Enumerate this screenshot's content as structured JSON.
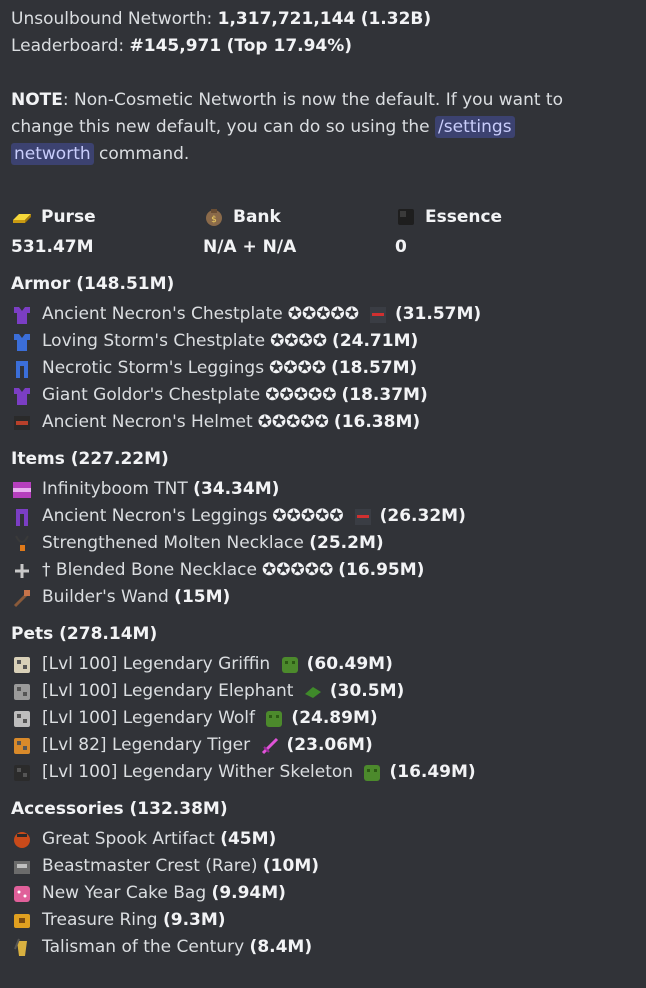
{
  "header": {
    "networth_label": "Unsoulbound Networth:",
    "networth_value": "1,317,721,144",
    "networth_short": "(1.32B)",
    "leaderboard_label": "Leaderboard:",
    "leaderboard_rank": "#145,971",
    "leaderboard_top": "(Top 17.94%)"
  },
  "note": {
    "label": "NOTE",
    "text1": ": Non-Cosmetic Networth is now the default. If you want to",
    "text2": "change this new default, you can do so using the",
    "command_part1": "/settings",
    "command_part2": "networth",
    "text3": "command."
  },
  "fields": [
    {
      "name": "Purse",
      "value": "531.47M",
      "icon": "gold-ingot-icon"
    },
    {
      "name": "Bank",
      "value": "N/A + N/A",
      "icon": "bank-bag-icon"
    },
    {
      "name": "Essence",
      "value": "0",
      "icon": "essence-icon"
    }
  ],
  "sections": {
    "armor": {
      "title": "Armor (148.51M)",
      "items": [
        {
          "name": "Ancient Necron's Chestplate",
          "stars": "✪✪✪✪✪",
          "value": "(31.57M)",
          "icon": "chestplate-icon",
          "extra": "necron-head-icon",
          "color": "#7b3ec4"
        },
        {
          "name": "Loving Storm's Chestplate",
          "stars": "✪✪✪✪",
          "value": "(24.71M)",
          "icon": "chestplate-icon",
          "color": "#3b6ed8"
        },
        {
          "name": "Necrotic Storm's Leggings",
          "stars": "✪✪✪✪",
          "value": "(18.57M)",
          "icon": "leggings-icon",
          "color": "#3b6ed8"
        },
        {
          "name": "Giant Goldor's Chestplate",
          "stars": "✪✪✪✪✪",
          "value": "(18.37M)",
          "icon": "chestplate-icon",
          "color": "#7b3ec4"
        },
        {
          "name": "Ancient Necron's Helmet",
          "stars": "✪✪✪✪✪",
          "value": "(16.38M)",
          "icon": "helmet-icon",
          "color": "#b8402a"
        }
      ]
    },
    "items": {
      "title": "Items (227.22M)",
      "items": [
        {
          "name": "Infinityboom TNT",
          "stars": "",
          "value": "(34.34M)",
          "icon": "tnt-icon",
          "color": "#b53fbd"
        },
        {
          "name": "Ancient Necron's Leggings",
          "stars": "✪✪✪✪✪",
          "value": "(26.32M)",
          "icon": "leggings-icon",
          "extra": "necron-head-icon",
          "color": "#7b3ec4"
        },
        {
          "name": "Strengthened Molten Necklace",
          "stars": "",
          "value": "(25.2M)",
          "icon": "necklace-icon",
          "color": "#e07a1a"
        },
        {
          "name": "† Blended Bone Necklace",
          "stars": "✪✪✪✪✪",
          "value": "(16.95M)",
          "icon": "bone-necklace-icon",
          "color": "#c9c9c9"
        },
        {
          "name": "Builder's Wand",
          "stars": "",
          "value": "(15M)",
          "icon": "wand-icon",
          "color": "#c8744a"
        }
      ]
    },
    "pets": {
      "title": "Pets (278.14M)",
      "items": [
        {
          "name": "[Lvl 100] Legendary Griffin",
          "stars": "",
          "value": "(60.49M)",
          "icon": "griffin-icon",
          "extra": "slime-cube-icon",
          "color": "#d8d0b8"
        },
        {
          "name": "[Lvl 100] Legendary Elephant",
          "stars": "",
          "value": "(30.5M)",
          "icon": "elephant-icon",
          "extra": "leaf-icon",
          "color": "#9a9a9a"
        },
        {
          "name": "[Lvl 100] Legendary Wolf",
          "stars": "",
          "value": "(24.89M)",
          "icon": "wolf-icon",
          "extra": "slime-cube-icon",
          "color": "#bdbdbd"
        },
        {
          "name": "[Lvl 82] Legendary Tiger",
          "stars": "",
          "value": "(23.06M)",
          "icon": "tiger-icon",
          "extra": "sword-icon",
          "color": "#d98a2a"
        },
        {
          "name": "[Lvl 100] Legendary Wither Skeleton",
          "stars": "",
          "value": "(16.49M)",
          "icon": "wither-skeleton-icon",
          "extra": "slime-cube-icon",
          "color": "#2b2b2b"
        }
      ]
    },
    "accessories": {
      "title": "Accessories (132.38M)",
      "items": [
        {
          "name": "Great Spook Artifact",
          "stars": "",
          "value": "(45M)",
          "icon": "spook-icon",
          "color": "#c84a1a"
        },
        {
          "name": "Beastmaster Crest (Rare)",
          "stars": "",
          "value": "(10M)",
          "icon": "crest-icon",
          "color": "#6b6b6b"
        },
        {
          "name": "New Year Cake Bag",
          "stars": "",
          "value": "(9.94M)",
          "icon": "cake-bag-icon",
          "color": "#e0609a"
        },
        {
          "name": "Treasure Ring",
          "stars": "",
          "value": "(9.3M)",
          "icon": "ring-icon",
          "color": "#e0a020"
        },
        {
          "name": "Talisman of the Century",
          "stars": "",
          "value": "(8.4M)",
          "icon": "talisman-icon",
          "color": "#d8b040"
        }
      ]
    }
  }
}
